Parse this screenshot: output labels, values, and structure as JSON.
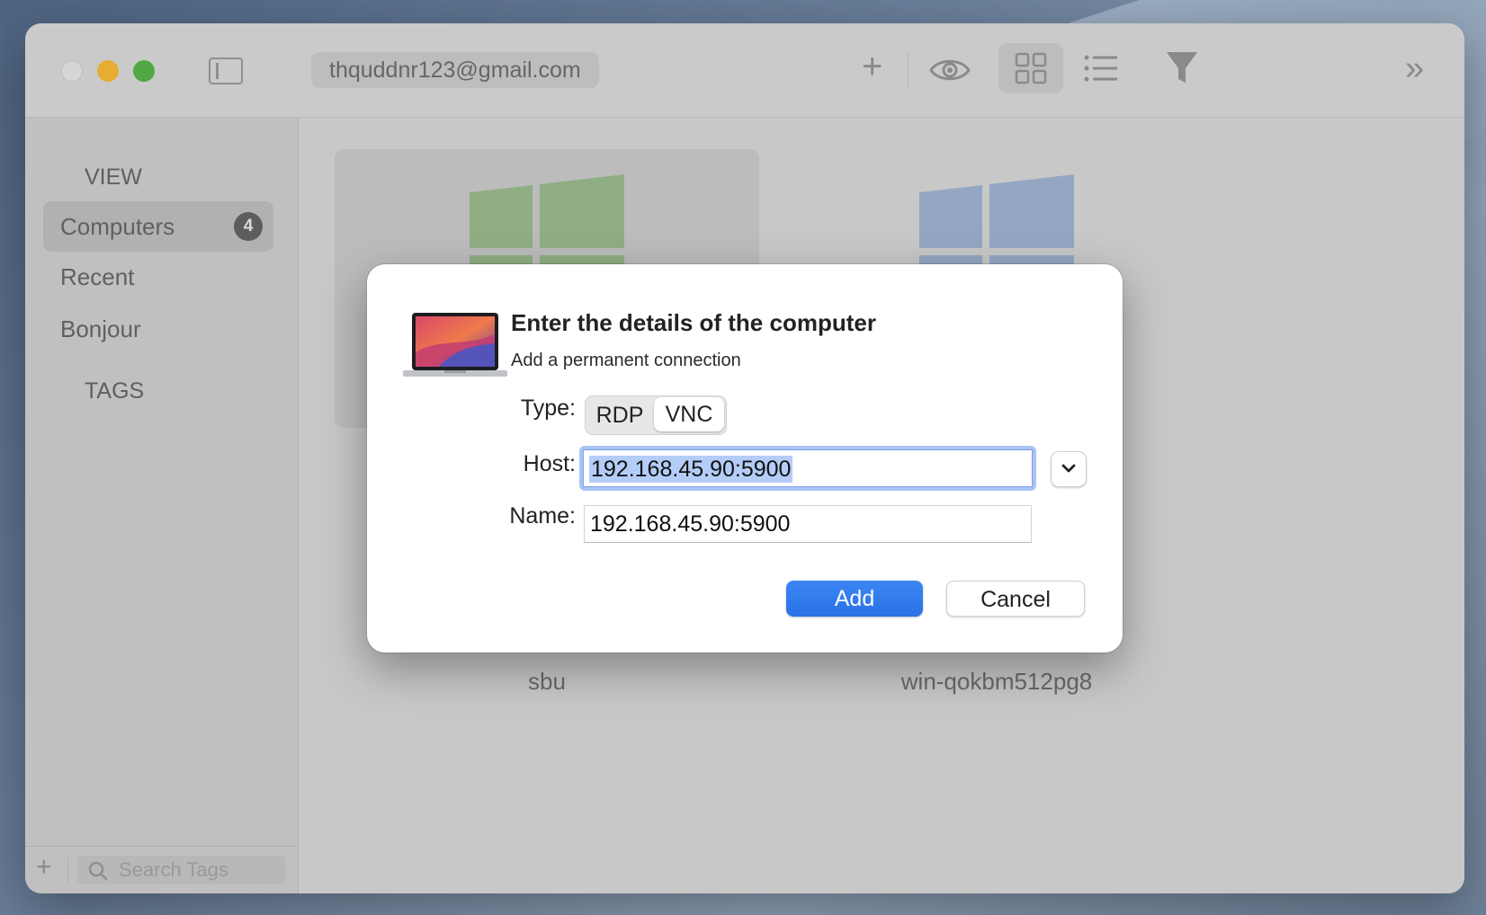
{
  "toolbar": {
    "account_label": "thquddnr123@gmail.com",
    "add_icon": "plus-icon",
    "view_icon": "eye-icon",
    "grid_icon": "grid-view-icon",
    "list_icon": "list-view-icon",
    "filter_icon": "filter-icon",
    "more_icon": "chevron-double-right-icon"
  },
  "sidebar": {
    "view_header": "VIEW",
    "items": [
      {
        "label": "Computers",
        "badge": "4",
        "selected": true
      },
      {
        "label": "Recent"
      },
      {
        "label": "Bonjour"
      }
    ],
    "tags_header": "TAGS",
    "search_placeholder": "Search Tags",
    "add_label": "+"
  },
  "computers": [
    {
      "name": "sbu",
      "logo_color": "#8fae84"
    },
    {
      "name": "win-qokbm512pg8",
      "logo_color": "#93a7c3"
    }
  ],
  "dialog": {
    "title": "Enter the details of the computer",
    "subtitle": "Add a permanent connection",
    "type_label": "Type:",
    "type_options": [
      "RDP",
      "VNC"
    ],
    "type_selected": "VNC",
    "host_label": "Host:",
    "host_value": "192.168.45.90:5900",
    "name_label": "Name:",
    "name_value": "192.168.45.90:5900",
    "add_button": "Add",
    "cancel_button": "Cancel"
  },
  "colors": {
    "accent": "#2f7bef",
    "close": "#d6d6d6",
    "minimize": "#e6ad31",
    "maximize": "#52a844"
  }
}
